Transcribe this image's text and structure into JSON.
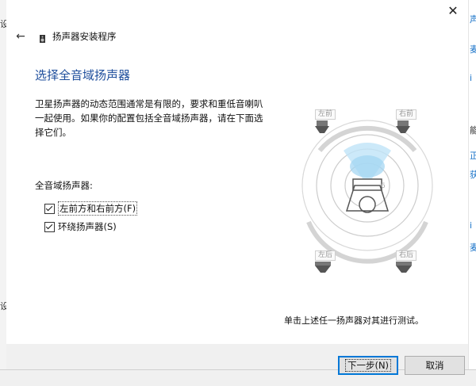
{
  "background": {
    "left_fragments": [
      "设",
      "设"
    ],
    "right_fragments": [
      "声",
      "麦",
      "i",
      "能",
      "正",
      "获",
      "i",
      "麦"
    ]
  },
  "dialog": {
    "close_glyph": "✕",
    "back_glyph": "←",
    "wizard_title": "扬声器安装程序",
    "heading": "选择全音域扬声器",
    "description": "卫星扬声器的动态范围通常是有限的，要求和重低音喇叭一起使用。如果你的配置包括全音域扬声器，请在下面选择它们。",
    "group_label": "全音域扬声器:",
    "options": [
      {
        "label": "左前方和右前方(F)",
        "checked": true
      },
      {
        "label": "环绕扬声器(S)",
        "checked": true
      }
    ],
    "speakers": {
      "front_left": "左前",
      "front_right": "右前",
      "rear_left": "左后",
      "rear_right": "右后"
    },
    "instruction": "单击上述任一扬声器对其进行测试。",
    "buttons": {
      "next": "下一步(N)",
      "cancel": "取消"
    }
  },
  "colors": {
    "heading": "#1e4e9c",
    "accent": "#0078d7",
    "footer": "#f0f0f0"
  }
}
